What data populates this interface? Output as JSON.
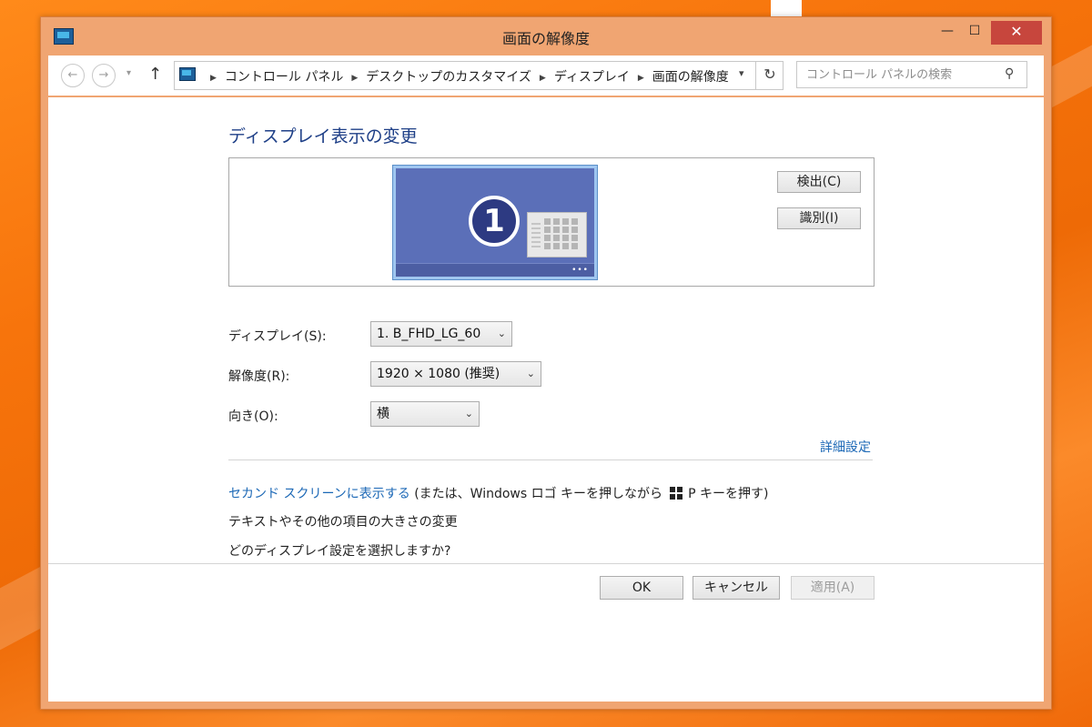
{
  "window": {
    "title": "画面の解像度",
    "min_glyph": "—",
    "max_glyph": "☐",
    "close_glyph": "✕"
  },
  "nav": {
    "back_glyph": "←",
    "forward_glyph": "→",
    "history_glyph": "▾",
    "up_glyph": "↑",
    "breadcrumbs": [
      "コントロール パネル",
      "デスクトップのカスタマイズ",
      "ディスプレイ",
      "画面の解像度"
    ],
    "crumb_separator": "▶",
    "dropdown_glyph": "▾",
    "refresh_glyph": "↻",
    "search_placeholder": "コントロール パネルの検索",
    "search_glyph": "⚲"
  },
  "main": {
    "heading": "ディスプレイ表示の変更",
    "monitor": {
      "number": "1",
      "dots": "•••"
    },
    "detect_label": "検出(C)",
    "identify_label": "識別(I)",
    "display_label": "ディスプレイ(S):",
    "display_value": "1. B_FHD_LG_60",
    "resolution_label": "解像度(R):",
    "resolution_value": "1920 × 1080 (推奨)",
    "orientation_label": "向き(O):",
    "orientation_value": "横",
    "select_chevron": "⌄",
    "advanced_link": "詳細設定",
    "second_screen_link": "セカンド スクリーンに表示する",
    "second_screen_text_a": "(または、Windows ロゴ キーを押しながら",
    "second_screen_text_b": "P キーを押す)",
    "text_size_link": "テキストやその他の項目の大きさの変更",
    "which_settings_link": "どのディスプレイ設定を選択しますか?"
  },
  "footer": {
    "ok_label": "OK",
    "cancel_label": "キャンセル",
    "apply_label": "適用(A)"
  },
  "colors": {
    "accent": "#1c68b6",
    "heading": "#1e3f87",
    "desktop": "#f7740c",
    "close": "#c7463d"
  }
}
